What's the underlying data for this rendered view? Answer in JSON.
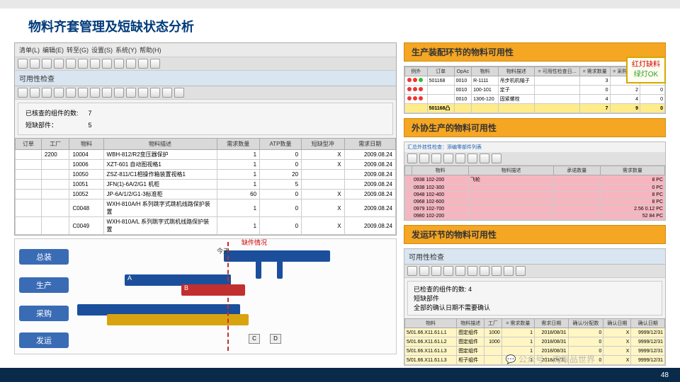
{
  "page": {
    "title": "物料齐套管理及短缺状态分析",
    "num": "48"
  },
  "footer": {
    "watermark": "公众号：肉眼品世界"
  },
  "menu": {
    "list": "清单(L)",
    "edit": "编辑(E)",
    "goto": "转至(G)",
    "settings": "设置(S)",
    "system": "系统(Y)",
    "help": "帮助(H)"
  },
  "pane": {
    "title": "可用性检查"
  },
  "info": {
    "checked_label": "已核查的组件的数:",
    "checked_val": "7",
    "short_label": "短缺部件：",
    "short_val": "5"
  },
  "cols": {
    "order": "订单",
    "plant": "工厂",
    "material": "物料",
    "desc": "物料描述",
    "req": "需求数量",
    "atp": "ATP数量",
    "shorttype": "短缺型冲",
    "reqdate": "需求日期"
  },
  "rows": [
    {
      "plant": "2200",
      "mat": "10004",
      "desc": "WBH-812/R2变压器保护",
      "req": "1",
      "atp": "0",
      "st": "X",
      "date": "2009.08.24"
    },
    {
      "plant": "",
      "mat": "10006",
      "desc": "XZT-601 自动图视格1",
      "req": "1",
      "atp": "0",
      "st": "X",
      "date": "2009.08.24"
    },
    {
      "plant": "",
      "mat": "10050",
      "desc": "ZSZ-811/C1相操作箱装置视格1",
      "req": "1",
      "atp": "20",
      "st": "",
      "date": "2009.08.24"
    },
    {
      "plant": "",
      "mat": "10051",
      "desc": "JFN(1)-6A/2/G1 机柜",
      "req": "1",
      "atp": "5",
      "st": "",
      "date": "2009.08.24"
    },
    {
      "plant": "",
      "mat": "10052",
      "desc": "JP-6A/1/2/G1-3标准柜",
      "req": "60",
      "atp": "0",
      "st": "X",
      "date": "2009.08.24"
    },
    {
      "plant": "",
      "mat": "C0048",
      "desc": "WXH-810A/H 系列跳字式跳机线路保护装置",
      "req": "1",
      "atp": "0",
      "st": "X",
      "date": "2009.08.24"
    },
    {
      "plant": "",
      "mat": "C0049",
      "desc": "WXH-810A/L 系列跳字式跳机线路保护装置",
      "req": "1",
      "atp": "0",
      "st": "X",
      "date": "2009.08.24"
    }
  ],
  "gantt": {
    "l1": "总装",
    "l2": "生产",
    "l3": "采购",
    "l4": "发运",
    "today": "今天",
    "short": "缺件情况",
    "A": "A",
    "B": "B",
    "C": "C",
    "D": "D"
  },
  "sec1": {
    "title": "生产装配环节的物料可用性"
  },
  "sec1cols": {
    "exc": "例外",
    "order": "订单",
    "op": "OpAc",
    "mat": "物料",
    "desc": "物料描述",
    "avail": "= 可用性检查日...",
    "req": "= 需求数量",
    "conf": "= 采购订单",
    "recv": "= 提货数"
  },
  "sec1rows": [
    {
      "exc": "rrg",
      "order": "501168",
      "op": "0010",
      "mat": "R-1111",
      "desc": "吊步机机轴子",
      "req": "3",
      "conf": "3",
      "recv": "0"
    },
    {
      "exc": "rrr",
      "order": "",
      "op": "0010",
      "mat": "100-101",
      "desc": "定子",
      "req": "0",
      "conf": "2",
      "recv": "0"
    },
    {
      "exc": "rrr",
      "order": "",
      "op": "0010",
      "mat": "1306-120",
      "desc": "固紧螺栓",
      "req": "4",
      "conf": "4",
      "recv": "0"
    },
    {
      "exc": "sum",
      "order": "501168凸",
      "op": "",
      "mat": "",
      "desc": "",
      "req": "7",
      "conf": "9",
      "recv": "0"
    }
  ],
  "legend": {
    "red": "红灯缺料",
    "green": "绿灯OK"
  },
  "sec2": {
    "title": "外协生产的物料可用性",
    "sub": "汇总外挂性检查：添编零部件列表"
  },
  "sec2cols": {
    "mat": "物料",
    "desc": "物料描述",
    "date": "承诺数量",
    "qty": "需求数量"
  },
  "sec2rows": [
    {
      "mat": "0938 102-200",
      "desc": "飞轮",
      "q": "8 PC"
    },
    {
      "mat": "0938 102-300",
      "desc": "",
      "q": "0 PC"
    },
    {
      "mat": "0948 102-400",
      "desc": "",
      "q": "8 PC"
    },
    {
      "mat": "0968 102-600",
      "desc": "",
      "q": "8 PC"
    },
    {
      "mat": "0979 102-700",
      "desc": "",
      "q": "2.56  0.12 PC"
    },
    {
      "mat": "0980 102-200",
      "desc": "",
      "q": "52  84 PC"
    }
  ],
  "sec3": {
    "title": "发运环节的物料可用性",
    "pane": "可用性检查"
  },
  "sec3info": {
    "l1": "已检查的组件的数:",
    "v1": "4",
    "l2": "短缺部件",
    "l3": "全部的确认日期不需要确认"
  },
  "sec3cols": {
    "mat": "物料",
    "desc": "物料描述",
    "plant": "工厂",
    "req": "= 需求数量",
    "reqd": "需求日期",
    "conf": "确认/分配数",
    "avail": "确认日期",
    "rd": "确认日期"
  },
  "sec3rows": [
    {
      "mat": "5/01.66.X11.61.L1",
      "desc": "图定组件",
      "plant": "1000",
      "req": "1",
      "reqd": "2018/08/31",
      "conf": "0",
      "av": "X",
      "rd": "9999/12/31"
    },
    {
      "mat": "5/01.66.X11.61.L2",
      "desc": "图定组件",
      "plant": "1000",
      "req": "1",
      "reqd": "2018/08/31",
      "conf": "0",
      "av": "X",
      "rd": "9999/12/31"
    },
    {
      "mat": "5/01.66.X11.61.L3",
      "desc": "图定组件",
      "plant": "",
      "req": "1",
      "reqd": "2018/08/31",
      "conf": "0",
      "av": "X",
      "rd": "9999/12/31"
    },
    {
      "mat": "5/01.66.X11.61.L3",
      "desc": "柜子组件",
      "plant": "",
      "req": "1",
      "reqd": "2018/08/31",
      "conf": "0",
      "av": "X",
      "rd": "9999/12/31"
    }
  ]
}
